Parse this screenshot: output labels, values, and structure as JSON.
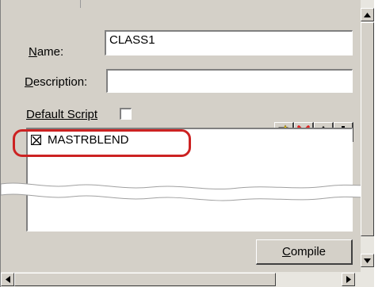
{
  "form": {
    "name_label_pre": "",
    "name_label_ul": "N",
    "name_label_post": "ame:",
    "name_value": "CLASS1",
    "desc_label_ul": "D",
    "desc_label_post": "escription:",
    "desc_value": "",
    "default_script_label": "Default Script",
    "default_script_checked": false
  },
  "toolbar": {
    "icons": [
      "new-script-icon",
      "delete-icon",
      "move-up-icon",
      "move-down-icon"
    ]
  },
  "list": {
    "items": [
      {
        "label": "MASTRBLEND",
        "checked": true
      }
    ]
  },
  "compile_button": {
    "label_ul": "C",
    "label_post": "ompile"
  },
  "colors": {
    "dialog_bg": "#d4d0c8",
    "highlight": "#cc2222",
    "delete_red": "#e02020"
  }
}
